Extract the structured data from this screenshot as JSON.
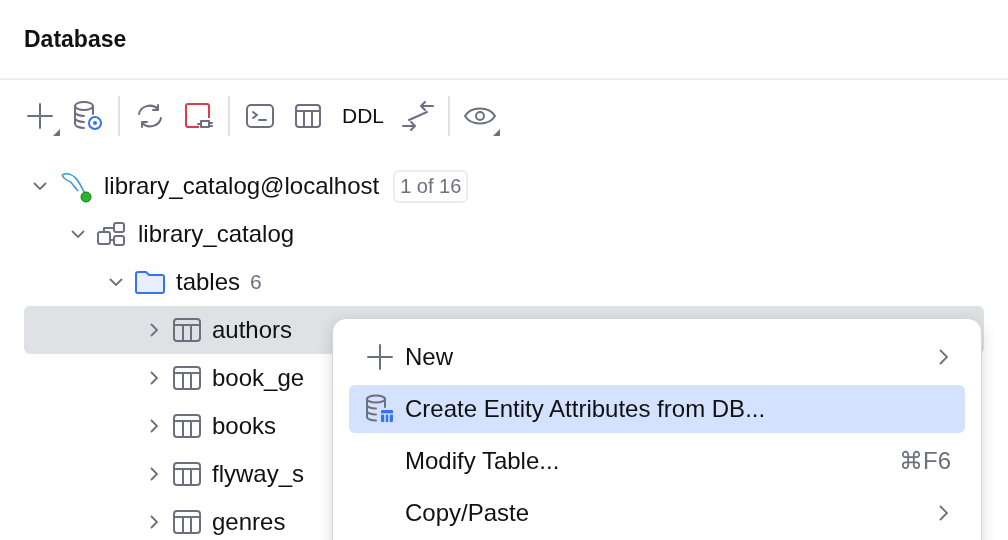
{
  "panel": {
    "title": "Database"
  },
  "toolbar": [
    {
      "kind": "add"
    },
    {
      "kind": "db-settings"
    },
    {
      "kind": "sep"
    },
    {
      "kind": "refresh"
    },
    {
      "kind": "disconnect"
    },
    {
      "kind": "sep"
    },
    {
      "kind": "console"
    },
    {
      "kind": "table"
    },
    {
      "kind": "text",
      "label": "DDL"
    },
    {
      "kind": "compare"
    },
    {
      "kind": "sep"
    },
    {
      "kind": "view"
    }
  ],
  "tree": [
    {
      "kind": "connection",
      "label": "library_catalog@localhost",
      "badge": "1 of 16",
      "connected": true,
      "expanded": true,
      "selected": false,
      "children": [
        {
          "kind": "schema",
          "label": "library_catalog",
          "expanded": true,
          "selected": false,
          "children": [
            {
              "kind": "folder",
              "label": "tables",
              "count": "6",
              "expanded": true,
              "selected": false,
              "children": [
                {
                  "kind": "table",
                  "label": "authors",
                  "expanded": false,
                  "selected": true
                },
                {
                  "kind": "table",
                  "label": "book_ge",
                  "expanded": false,
                  "selected": false
                },
                {
                  "kind": "table",
                  "label": "books",
                  "expanded": false,
                  "selected": false
                },
                {
                  "kind": "table",
                  "label": "flyway_s",
                  "expanded": false,
                  "selected": false
                },
                {
                  "kind": "table",
                  "label": "genres",
                  "expanded": false,
                  "selected": false
                }
              ]
            }
          ]
        }
      ]
    }
  ],
  "context_menu": [
    {
      "kind": "plus",
      "label": "New",
      "submenu": true,
      "selected": false
    },
    {
      "kind": "entity",
      "label": "Create Entity Attributes from DB...",
      "submenu": false,
      "selected": true
    },
    {
      "kind": "plain",
      "label": "Modify Table...",
      "shortcut": "⌘F6",
      "submenu": false,
      "selected": false
    },
    {
      "kind": "plain",
      "label": "Copy/Paste",
      "submenu": true,
      "selected": false
    }
  ]
}
